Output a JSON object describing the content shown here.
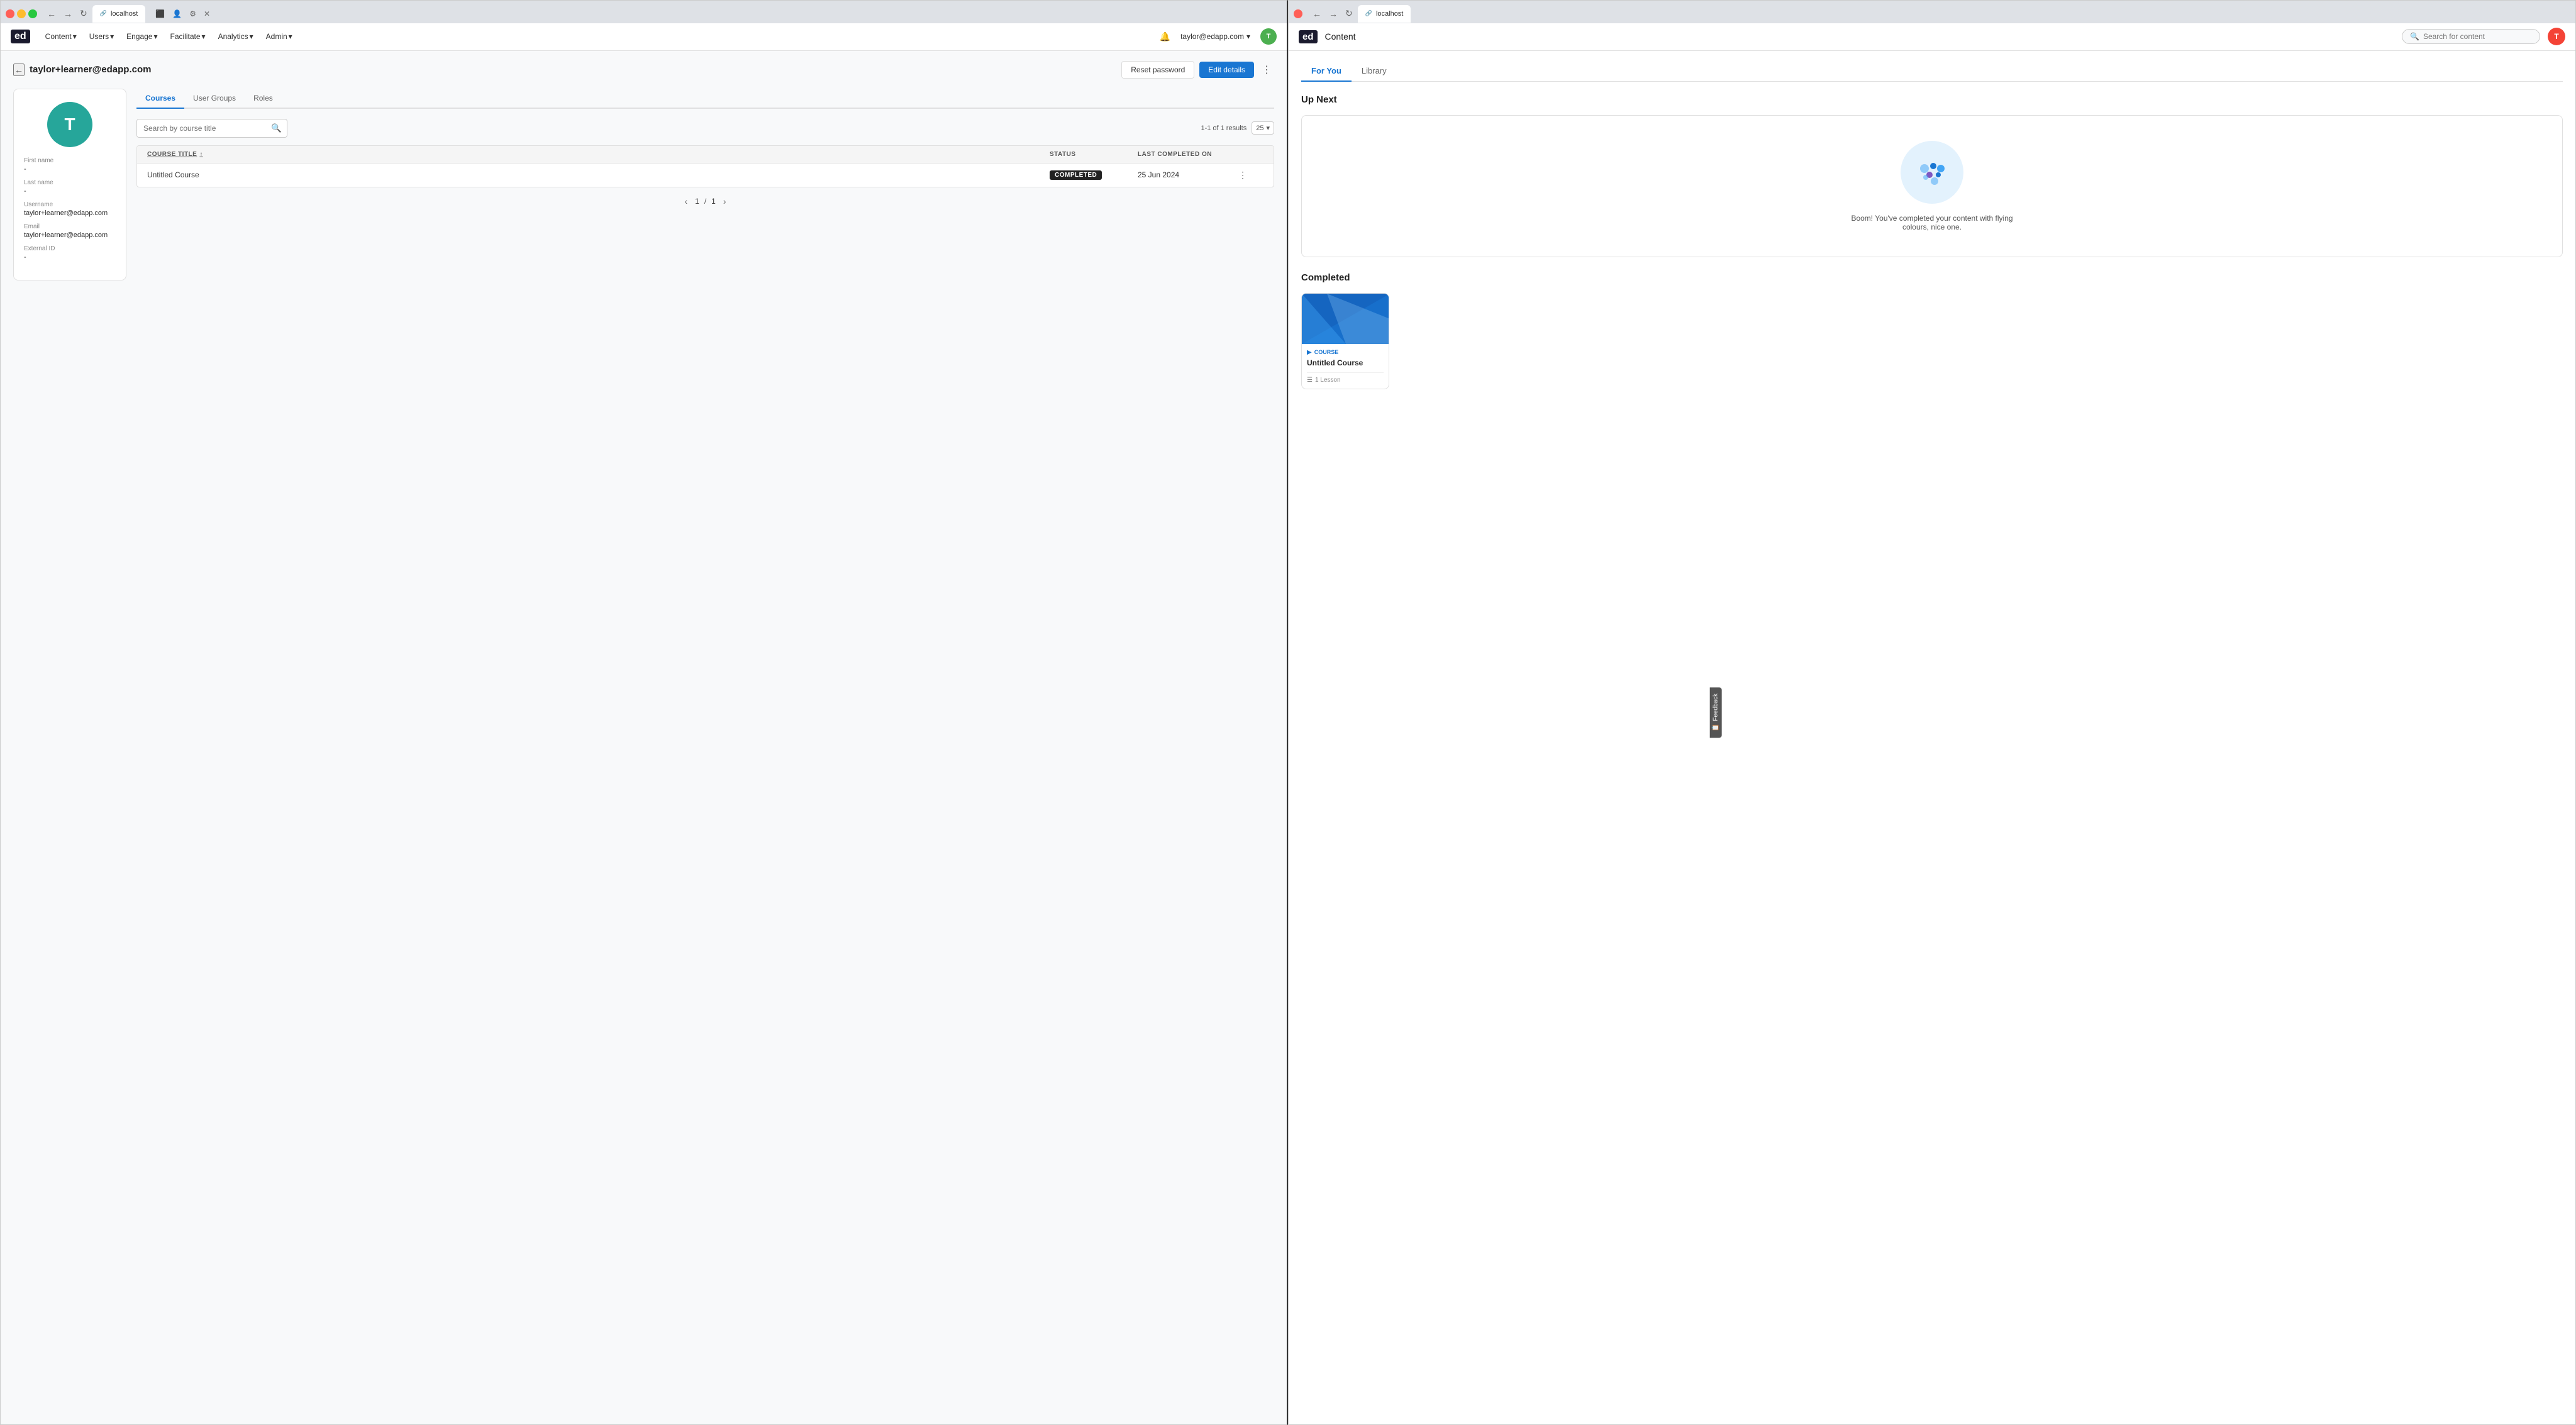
{
  "left_browser": {
    "tab_label": "localhost",
    "address": "localhost",
    "back_title": "taylor+learner@edapp.com",
    "btn_reset": "Reset password",
    "btn_edit": "Edit details",
    "logo": "ed",
    "nav": {
      "items": [
        {
          "label": "Content",
          "has_arrow": true
        },
        {
          "label": "Users",
          "has_arrow": true
        },
        {
          "label": "Engage",
          "has_arrow": true
        },
        {
          "label": "Facilitate",
          "has_arrow": true
        },
        {
          "label": "Analytics",
          "has_arrow": true
        },
        {
          "label": "Admin",
          "has_arrow": true
        }
      ]
    },
    "user_email": "taylor@edapp.com",
    "user_initial": "T",
    "profile": {
      "initial": "T",
      "first_name_label": "First name",
      "first_name_value": "-",
      "last_name_label": "Last name",
      "last_name_value": "-",
      "username_label": "Username",
      "username_value": "taylor+learner@edapp.com",
      "email_label": "Email",
      "email_value": "taylor+learner@edapp.com",
      "external_id_label": "External ID",
      "external_id_value": "-"
    },
    "tabs": [
      {
        "label": "Courses",
        "active": true
      },
      {
        "label": "User Groups",
        "active": false
      },
      {
        "label": "Roles",
        "active": false
      }
    ],
    "search_placeholder": "Search by course title",
    "results_text": "1-1 of 1 results",
    "per_page": "25",
    "table": {
      "columns": [
        {
          "label": "COURSE TITLE",
          "sortable": true
        },
        {
          "label": "STATUS"
        },
        {
          "label": "LAST COMPLETED ON"
        },
        {
          "label": ""
        }
      ],
      "rows": [
        {
          "title": "Untitled Course",
          "status": "COMPLETED",
          "last_completed": "25 Jun 2024"
        }
      ]
    },
    "pagination": {
      "current": "1",
      "separator": "/",
      "total": "1"
    },
    "feedback_label": "Feedback"
  },
  "right_browser": {
    "tab_label": "localhost",
    "address": "localhost",
    "logo": "ed",
    "nav_title": "Content",
    "search_placeholder": "Search for content",
    "user_initial": "T",
    "content_tabs": [
      {
        "label": "For You",
        "active": true
      },
      {
        "label": "Library",
        "active": false
      }
    ],
    "up_next_title": "Up Next",
    "up_next_message": "Boom! You've completed your content with flying colours, nice one.",
    "completed_title": "Completed",
    "course_card": {
      "badge_text": "COURSE",
      "title": "Untitled Course",
      "lessons": "1 Lesson"
    }
  }
}
